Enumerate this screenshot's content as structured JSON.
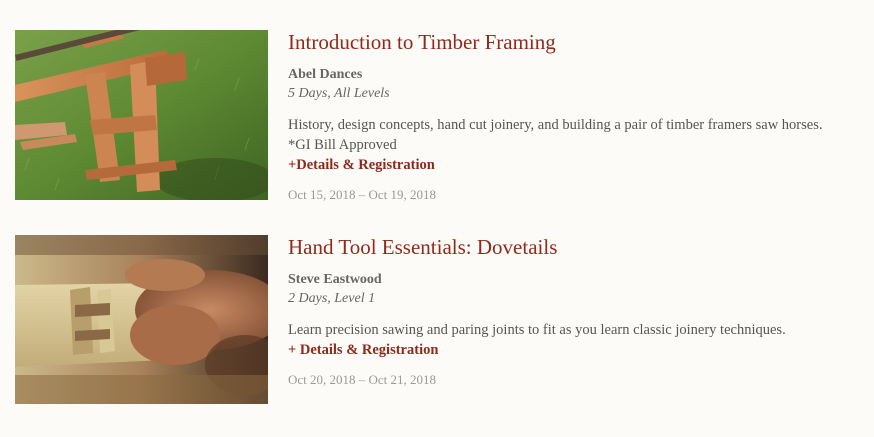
{
  "courses": [
    {
      "title": "Introduction to Timber Framing",
      "instructor": "Abel Dances",
      "meta": "5 Days, All Levels",
      "description": "History, design concepts, hand cut joinery, and building a pair of timber framers saw horses.",
      "note": "*GI Bill Approved",
      "link_label": "+Details & Registration",
      "dates": "Oct 15, 2018 – Oct 19, 2018",
      "image": "timber-sawhorse-photo"
    },
    {
      "title": "Hand Tool Essentials: Dovetails",
      "instructor": "Steve Eastwood",
      "meta": "2 Days, Level 1",
      "description": "Learn precision sawing and paring joints to fit as you learn classic joinery techniques.",
      "link_label": "+ Details & Registration",
      "dates": "Oct 20, 2018 – Oct 21, 2018",
      "image": "dovetail-joint-photo"
    }
  ],
  "colors": {
    "title": "#8e2a1c",
    "link": "#8e2a1c",
    "text": "#555555",
    "date": "#999999",
    "background": "#fdfbf8"
  }
}
